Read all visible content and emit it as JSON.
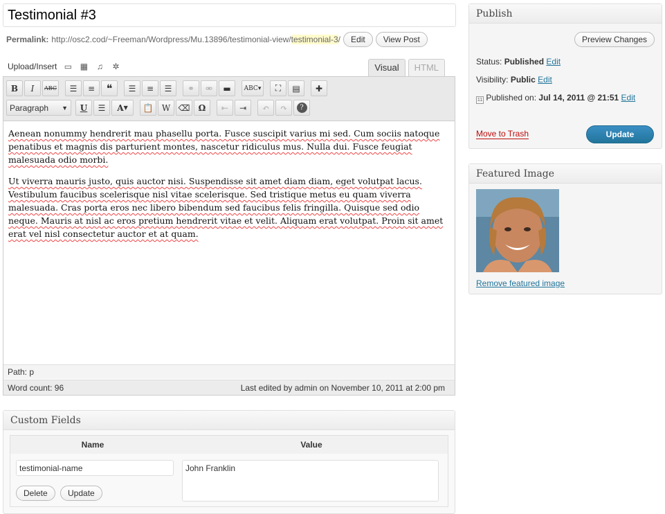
{
  "post": {
    "title": "Testimonial #3",
    "permalink_label": "Permalink:",
    "permalink_url": "http://osc2.cod/~Freeman/Wordpress/Mu.13896/testimonial-view/",
    "permalink_slug": "testimonial-3",
    "permalink_trailing": "/",
    "edit_label": "Edit",
    "view_post_label": "View Post"
  },
  "upload": {
    "label": "Upload/Insert",
    "icons": [
      "image-icon",
      "gallery-icon",
      "audio-icon",
      "media-icon"
    ]
  },
  "tabs": [
    {
      "label": "Visual",
      "active": true
    },
    {
      "label": "HTML",
      "active": false
    }
  ],
  "toolbar": {
    "format_select": "Paragraph",
    "row1_icons": [
      "bold-icon",
      "italic-icon",
      "strikethrough-icon",
      "bullet-list-icon",
      "numbered-list-icon",
      "blockquote-icon",
      "align-left-icon",
      "align-center-icon",
      "align-right-icon",
      "link-icon",
      "unlink-icon",
      "more-tag-icon",
      "spellcheck-icon",
      "fullscreen-icon",
      "kitchen-sink-icon",
      "plugin-icon"
    ],
    "row2_icons": [
      "underline-icon",
      "justify-icon",
      "text-color-icon",
      "paste-text-icon",
      "paste-word-icon",
      "remove-format-icon",
      "special-char-icon",
      "outdent-icon",
      "indent-icon",
      "undo-icon",
      "redo-icon",
      "help-icon"
    ]
  },
  "content": {
    "paragraphs": [
      "Aenean nonummy hendrerit mau phasellu porta. Fusce suscipit varius mi sed. Cum sociis natoque penatibus et magnis dis parturient montes, nascetur ridiculus mus. Nulla dui. Fusce feugiat malesuada odio morbi.",
      "Ut viverra mauris justo, quis auctor nisi. Suspendisse sit amet diam diam, eget volutpat lacus. Vestibulum faucibus scelerisque nisl vitae scelerisque. Sed tristique metus eu quam viverra malesuada. Cras porta eros nec libero bibendum sed faucibus felis fringilla. Quisque sed odio neque. Mauris at nisl ac eros pretium hendrerit vitae et velit. Aliquam erat volutpat. Proin sit amet erat vel nisl consectetur auctor et at quam."
    ],
    "path": "Path: p",
    "word_count": "Word count: 96",
    "last_edited": "Last edited by admin on November 10, 2011 at 2:00 pm"
  },
  "custom_fields": {
    "title": "Custom Fields",
    "name_header": "Name",
    "value_header": "Value",
    "name_value": "testimonial-name",
    "value_value": "John Franklin",
    "delete_label": "Delete",
    "update_label": "Update"
  },
  "publish": {
    "title": "Publish",
    "preview_label": "Preview Changes",
    "status_label": "Status:",
    "status_value": "Published",
    "visibility_label": "Visibility:",
    "visibility_value": "Public",
    "published_label": "Published on:",
    "published_value": "Jul 14, 2011 @ 21:51",
    "edit_label": "Edit",
    "trash_label": "Move to Trash",
    "update_label": "Update"
  },
  "featured": {
    "title": "Featured Image",
    "remove_label": "Remove featured image"
  }
}
